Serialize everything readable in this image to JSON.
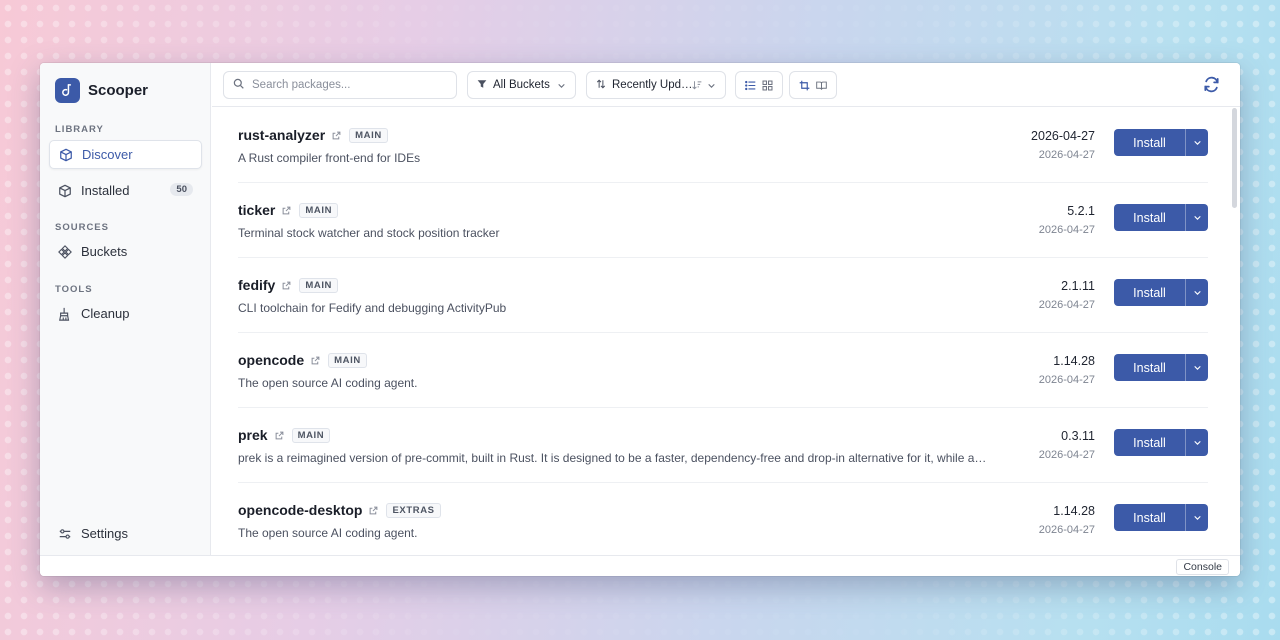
{
  "app": {
    "title": "Scooper"
  },
  "sidebar": {
    "sections": {
      "library": "LIBRARY",
      "sources": "SOURCES",
      "tools": "TOOLS"
    },
    "items": {
      "discover": "Discover",
      "installed": "Installed",
      "installed_count": "50",
      "buckets": "Buckets",
      "cleanup": "Cleanup",
      "settings": "Settings"
    },
    "active_item": "Discover"
  },
  "toolbar": {
    "search_placeholder": "Search packages...",
    "bucket_filter": "All Buckets",
    "sort": "Recently Upd…"
  },
  "packages": [
    {
      "name": "rust-analyzer",
      "bucket": "MAIN",
      "description": "A Rust compiler front-end for IDEs",
      "version": "2026-04-27",
      "date": "2026-04-27",
      "action": "Install"
    },
    {
      "name": "ticker",
      "bucket": "MAIN",
      "description": "Terminal stock watcher and stock position tracker",
      "version": "5.2.1",
      "date": "2026-04-27",
      "action": "Install"
    },
    {
      "name": "fedify",
      "bucket": "MAIN",
      "description": "CLI toolchain for Fedify and debugging ActivityPub",
      "version": "2.1.11",
      "date": "2026-04-27",
      "action": "Install"
    },
    {
      "name": "opencode",
      "bucket": "MAIN",
      "description": "The open source AI coding agent.",
      "version": "1.14.28",
      "date": "2026-04-27",
      "action": "Install"
    },
    {
      "name": "prek",
      "bucket": "MAIN",
      "description": "prek is a reimagined version of pre-commit, built in Rust. It is designed to be a faster, dependency-free and drop-in alternative for it, while a…",
      "version": "0.3.11",
      "date": "2026-04-27",
      "action": "Install"
    },
    {
      "name": "opencode-desktop",
      "bucket": "EXTRAS",
      "description": "The open source AI coding agent.",
      "version": "1.14.28",
      "date": "2026-04-27",
      "action": "Install"
    }
  ],
  "statusbar": {
    "console_label": "Console"
  },
  "colors": {
    "accent": "#3c5aa8",
    "sidebar_bg": "#f8f9fa",
    "text": "#1a1e28"
  }
}
